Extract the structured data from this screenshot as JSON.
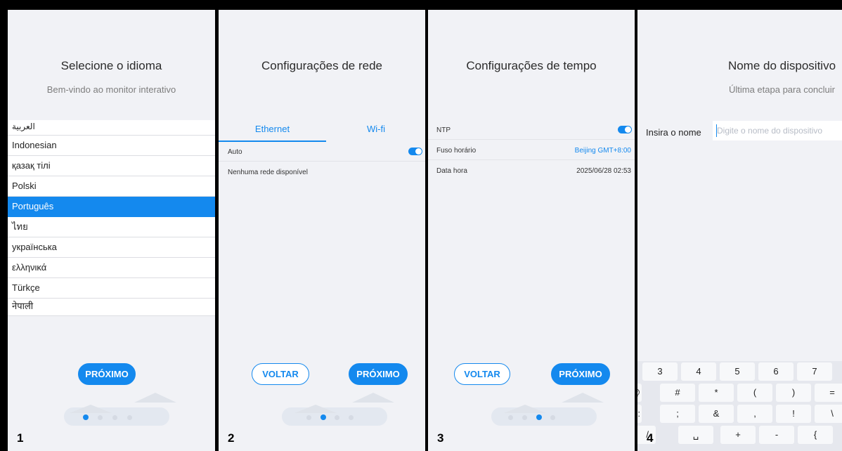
{
  "panels": [
    {
      "step": "1",
      "title": "Selecione o idioma",
      "subtitle": "Bem-vindo ao monitor interativo",
      "languages": [
        "العربية",
        "Indonesian",
        "қазақ тілі",
        "Polski",
        "Português",
        "ไทย",
        "українська",
        "ελληνικά",
        "Türkçe",
        "नेपाली"
      ],
      "selected_language": "Português",
      "next_label": "PRÓXIMO"
    },
    {
      "step": "2",
      "title": "Configurações de rede",
      "tabs": [
        "Ethernet",
        "Wi-fi"
      ],
      "auto_label": "Auto",
      "auto_enabled": true,
      "no_network_text": "Nenhuma rede disponível",
      "back_label": "VOLTAR",
      "next_label": "PRÓXIMO"
    },
    {
      "step": "3",
      "title": "Configurações de tempo",
      "ntp_label": "NTP",
      "ntp_enabled": true,
      "timezone_label": "Fuso horário",
      "timezone_value": "Beijing GMT+8:00",
      "datetime_label": "Data hora",
      "datetime_value": "2025/06/28 02:53",
      "back_label": "VOLTAR",
      "next_label": "PRÓXIMO"
    },
    {
      "step": "4",
      "title": "Nome do dispositivo",
      "subtitle": "Última etapa para concluir",
      "name_label": "Insira o nome",
      "name_placeholder": "Digite o nome do dispositivo",
      "keyboard_rows": [
        [
          "3",
          "4",
          "5",
          "6",
          "7"
        ],
        [
          "@",
          "#",
          "*",
          "(",
          ")",
          "="
        ],
        [
          ":",
          ";",
          "&",
          ",",
          "!",
          "\\"
        ],
        [
          "/",
          "␣",
          "+",
          "-",
          "{"
        ]
      ]
    }
  ],
  "colors": {
    "accent": "#1489ee",
    "panel_bg": "#f1f2f6",
    "divider": "#000000"
  }
}
